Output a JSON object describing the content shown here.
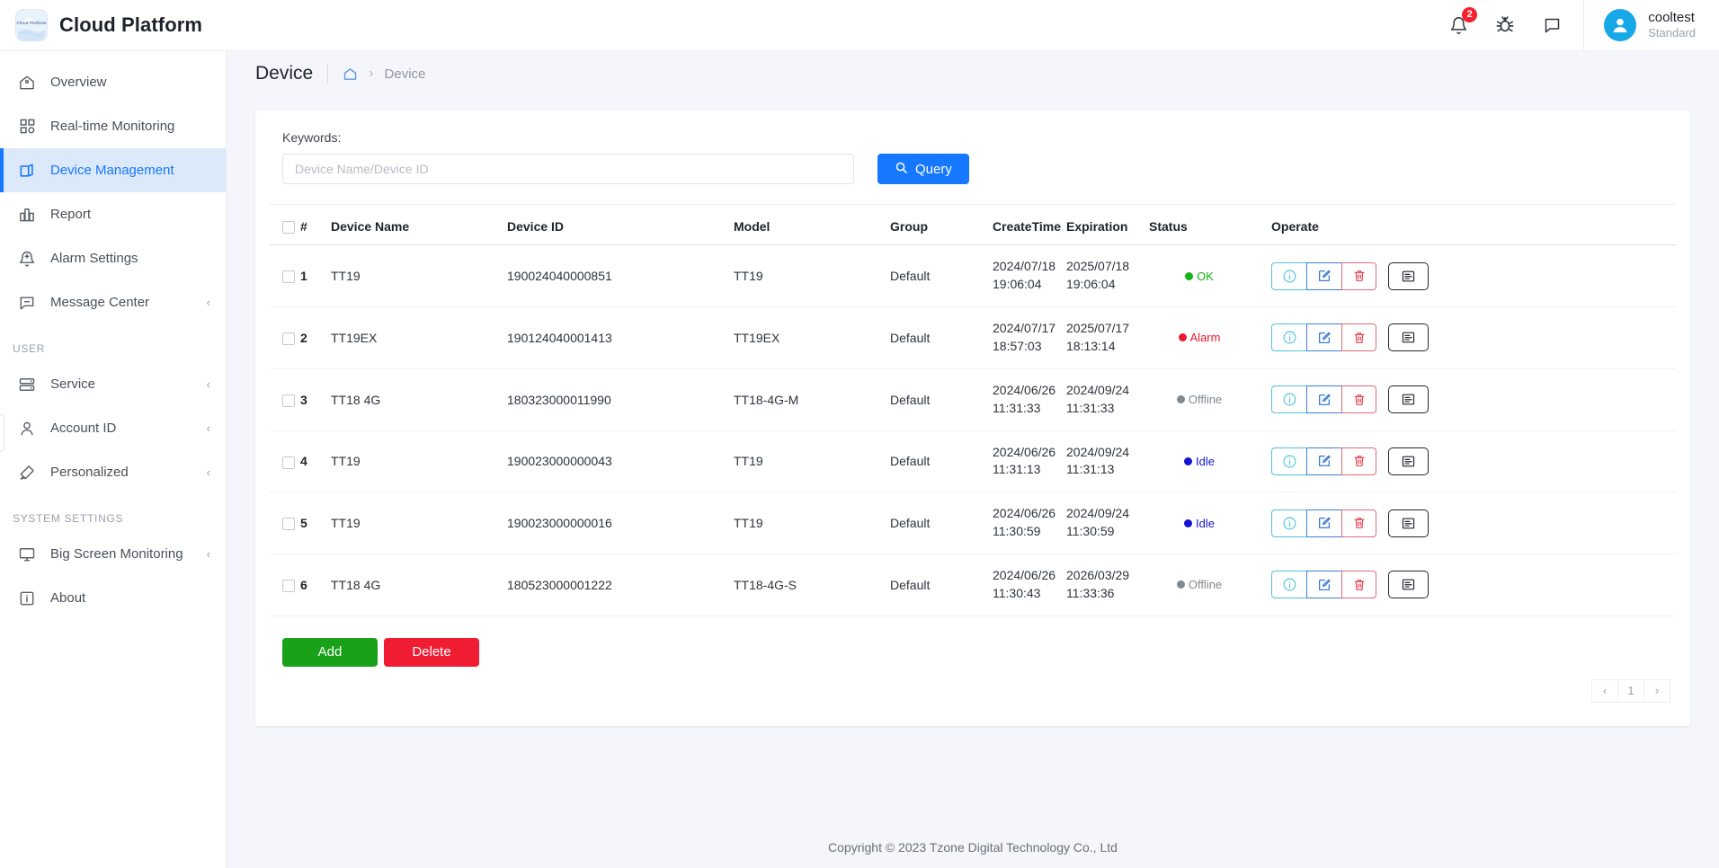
{
  "header": {
    "brand": "Cloud Platform",
    "logo_text": "Cloud Platform",
    "icons": [
      {
        "name": "bell-icon",
        "badge": "2"
      },
      {
        "name": "bug-icon",
        "badge": ""
      },
      {
        "name": "message-icon",
        "badge": ""
      }
    ],
    "user": {
      "name": "cooltest",
      "role": "Standard"
    }
  },
  "sidebar": {
    "items": [
      {
        "label": "Overview",
        "icon": "home-icon",
        "active": false,
        "arrow": ""
      },
      {
        "label": "Real-time Monitoring",
        "icon": "grid-icon",
        "active": false,
        "arrow": ""
      },
      {
        "label": "Device Management",
        "icon": "device-icon",
        "active": true,
        "arrow": ""
      },
      {
        "label": "Report",
        "icon": "chart-icon",
        "active": false,
        "arrow": ""
      },
      {
        "label": "Alarm Settings",
        "icon": "alarm-bell-icon",
        "active": false,
        "arrow": ""
      },
      {
        "label": "Message Center",
        "icon": "chat-icon",
        "active": false,
        "arrow": "‹"
      }
    ],
    "group_user": "USER",
    "user_items": [
      {
        "label": "Service",
        "icon": "server-icon",
        "arrow": "‹"
      },
      {
        "label": "Account ID",
        "icon": "person-icon",
        "arrow": "‹"
      },
      {
        "label": "Personalized",
        "icon": "brush-icon",
        "arrow": "‹"
      }
    ],
    "group_system": "SYSTEM SETTINGS",
    "system_items": [
      {
        "label": "Big Screen Monitoring",
        "icon": "monitor-icon",
        "arrow": "‹"
      },
      {
        "label": "About",
        "icon": "info-square-icon",
        "arrow": ""
      }
    ]
  },
  "breadcrumb": {
    "page_title": "Device",
    "home_icon": "home-icon",
    "separator": "›",
    "current": "Device"
  },
  "filter": {
    "label": "Keywords:",
    "placeholder": "Device Name/Device ID",
    "value": "",
    "query_label": "Query",
    "query_icon": "search-icon"
  },
  "table": {
    "columns": [
      "#",
      "Device Name",
      "Device ID",
      "Model",
      "Group",
      "CreateTime",
      "Expiration",
      "Status",
      "Operate"
    ],
    "rows": [
      {
        "index": "1",
        "device_name": "TT19",
        "device_id": "190024040000851",
        "model": "TT19",
        "group": "Default",
        "create_date": "2024/07/18",
        "create_time": "19:06:04",
        "expire_date": "2025/07/18",
        "expire_time": "19:06:04",
        "status": "OK",
        "status_color": "#12b312"
      },
      {
        "index": "2",
        "device_name": "TT19EX",
        "device_id": "190124040001413",
        "model": "TT19EX",
        "group": "Default",
        "create_date": "2024/07/17",
        "create_time": "18:57:03",
        "expire_date": "2025/07/17",
        "expire_time": "18:13:14",
        "status": "Alarm",
        "status_color": "#e8192c"
      },
      {
        "index": "3",
        "device_name": "TT18 4G",
        "device_id": "180323000011990",
        "model": "TT18-4G-M",
        "group": "Default",
        "create_date": "2024/06/26",
        "create_time": "11:31:33",
        "expire_date": "2024/09/24",
        "expire_time": "11:31:33",
        "status": "Offline",
        "status_color": "#808890"
      },
      {
        "index": "4",
        "device_name": "TT19",
        "device_id": "190023000000043",
        "model": "TT19",
        "group": "Default",
        "create_date": "2024/06/26",
        "create_time": "11:31:13",
        "expire_date": "2024/09/24",
        "expire_time": "11:31:13",
        "status": "Idle",
        "status_color": "#1414d2"
      },
      {
        "index": "5",
        "device_name": "TT19",
        "device_id": "190023000000016",
        "model": "TT19",
        "group": "Default",
        "create_date": "2024/06/26",
        "create_time": "11:30:59",
        "expire_date": "2024/09/24",
        "expire_time": "11:30:59",
        "status": "Idle",
        "status_color": "#1414d2"
      },
      {
        "index": "6",
        "device_name": "TT18 4G",
        "device_id": "180523000001222",
        "model": "TT18-4G-S",
        "group": "Default",
        "create_date": "2024/06/26",
        "create_time": "11:30:43",
        "expire_date": "2026/03/29",
        "expire_time": "11:33:36",
        "status": "Offline",
        "status_color": "#808890"
      }
    ],
    "operate_icons": [
      "info-icon",
      "edit-icon",
      "delete-icon",
      "log-icon"
    ]
  },
  "actions": {
    "add_label": "Add",
    "delete_label": "Delete"
  },
  "pagination": {
    "prev": "‹",
    "pages": [
      "1"
    ],
    "next": "›"
  },
  "footer": {
    "copyright": "Copyright © 2023 Tzone Digital Technology Co., Ltd"
  },
  "colors": {
    "accent": "#1677ff",
    "add": "#19a119",
    "delete": "#f01c32",
    "badge": "#f5222d",
    "avatar": "#17a8e8",
    "active_nav_bg": "#dce9fb"
  }
}
